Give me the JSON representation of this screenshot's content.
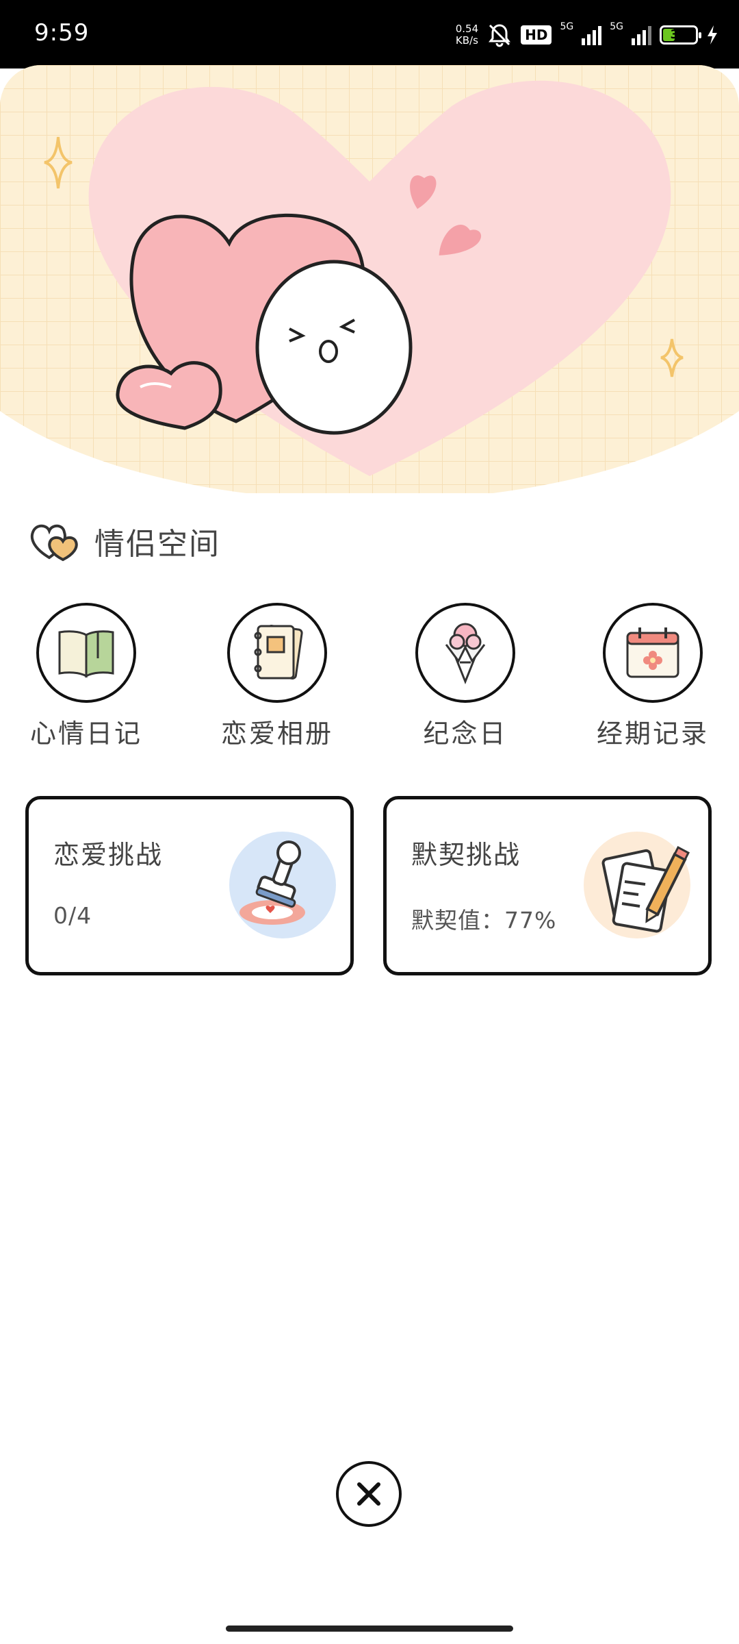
{
  "status_bar": {
    "time": "9:59",
    "net_speed_value": "0.54",
    "net_speed_unit": "KB/s",
    "hd_label": "HD",
    "signal_1": "5G",
    "signal_2": "5G",
    "battery_level": "32"
  },
  "section": {
    "title": "情侣空间",
    "icon": "double-heart-icon"
  },
  "features": [
    {
      "label": "心情日记",
      "icon": "diary-book-icon"
    },
    {
      "label": "恋爱相册",
      "icon": "photo-album-icon"
    },
    {
      "label": "纪念日",
      "icon": "flower-bouquet-icon"
    },
    {
      "label": "经期记录",
      "icon": "calendar-flower-icon"
    }
  ],
  "cards": [
    {
      "title": "恋爱挑战",
      "value": "0/4",
      "icon": "stamp-icon",
      "accent": "#d7e6f8"
    },
    {
      "title": "默契挑战",
      "value": "默契值：77%",
      "icon": "paper-pencil-icon",
      "accent": "#fdebd7"
    }
  ],
  "close": {
    "icon": "close-icon"
  },
  "colors": {
    "banner_bg": "#fdf0d5",
    "heart_pink": "#f8b5b8",
    "soft_pink": "#fcd9d9"
  }
}
